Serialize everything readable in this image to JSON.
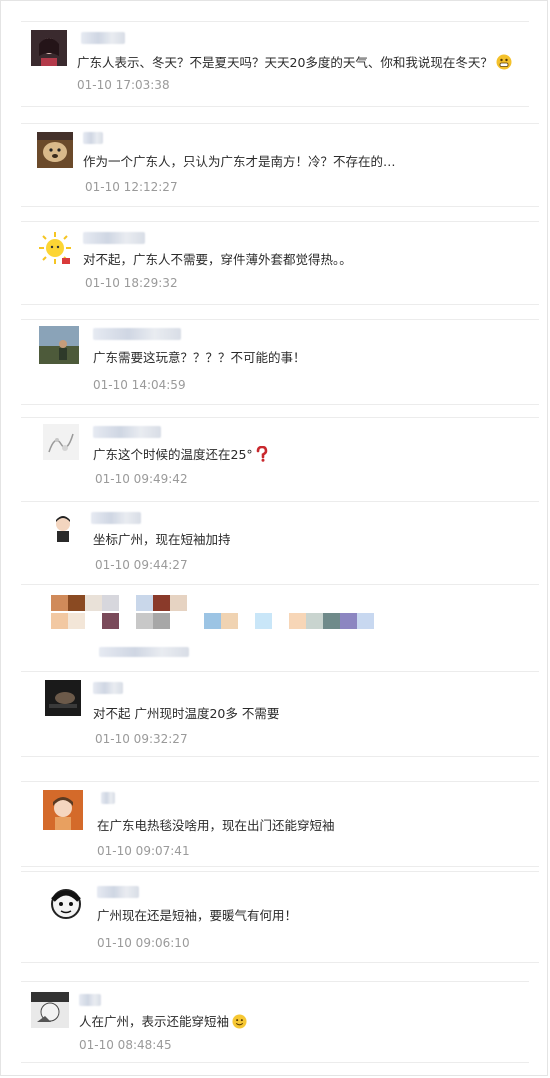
{
  "comments": [
    {
      "text": "广东人表示、冬天？不是夏天吗？天天20多度的天气、你和我说现在冬天？",
      "time": "01-10 17:03:38",
      "emoji": "grin-emoji"
    },
    {
      "text": "作为一个广东人，只认为广东才是南方！冷？不存在的…",
      "time": "01-10 12:12:27"
    },
    {
      "text": "对不起，广东人不需要，穿件薄外套都觉得热。。",
      "time": "01-10 18:29:32"
    },
    {
      "text": "广东需要这玩意？？？？不可能的事！",
      "time": "01-10 14:04:59"
    },
    {
      "text": "广东这个时候的温度还在25°",
      "time": "01-10 09:49:42",
      "emoji": "question-mark-emoji"
    },
    {
      "text": "坐标广州，现在短袖加持",
      "time": "01-10 09:44:27"
    },
    {
      "text": "对不起 广州现时温度20多 不需要",
      "time": "01-10 09:32:27"
    },
    {
      "text": "在广东电热毯没啥用，现在出门还能穿短袖",
      "time": "01-10 09:07:41"
    },
    {
      "text": "广州现在还是短袖，要暖气有何用！",
      "time": "01-10 09:06:10"
    },
    {
      "text": "人在广州，表示还能穿短袖",
      "time": "01-10 08:48:45",
      "emoji": "smile-emoji"
    }
  ]
}
